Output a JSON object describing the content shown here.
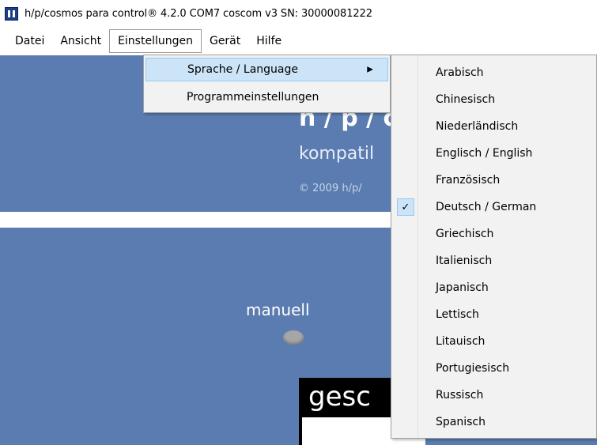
{
  "window": {
    "title": "h/p/cosmos para control® 4.2.0 COM7 coscom v3  SN: 30000081222",
    "icon": "app-icon"
  },
  "menubar": {
    "items": [
      "Datei",
      "Ansicht",
      "Einstellungen",
      "Gerät",
      "Hilfe"
    ],
    "active": "Einstellungen"
  },
  "splash": {
    "big_text": "h / p / c",
    "sub_text": "kompatil",
    "copyright": "© 2009 h/p/"
  },
  "main": {
    "mode_label": "manuell",
    "panel_text": "gesc"
  },
  "dropdown": {
    "items": [
      {
        "label": "Sprache / Language",
        "has_submenu": true
      },
      {
        "label": "Programmeinstellungen",
        "has_submenu": false
      }
    ]
  },
  "language_menu": {
    "items": [
      "Arabisch",
      "Chinesisch",
      "Niederländisch",
      "Englisch / English",
      "Französisch",
      "Deutsch / German",
      "Griechisch",
      "Italienisch",
      "Japanisch",
      "Lettisch",
      "Litauisch",
      "Portugiesisch",
      "Russisch",
      "Spanisch"
    ],
    "checked": "Deutsch / German",
    "check_icon": "checkmark-icon"
  },
  "colors": {
    "background_blue": "#5a7cb0",
    "highlight": "#cce4f7"
  }
}
